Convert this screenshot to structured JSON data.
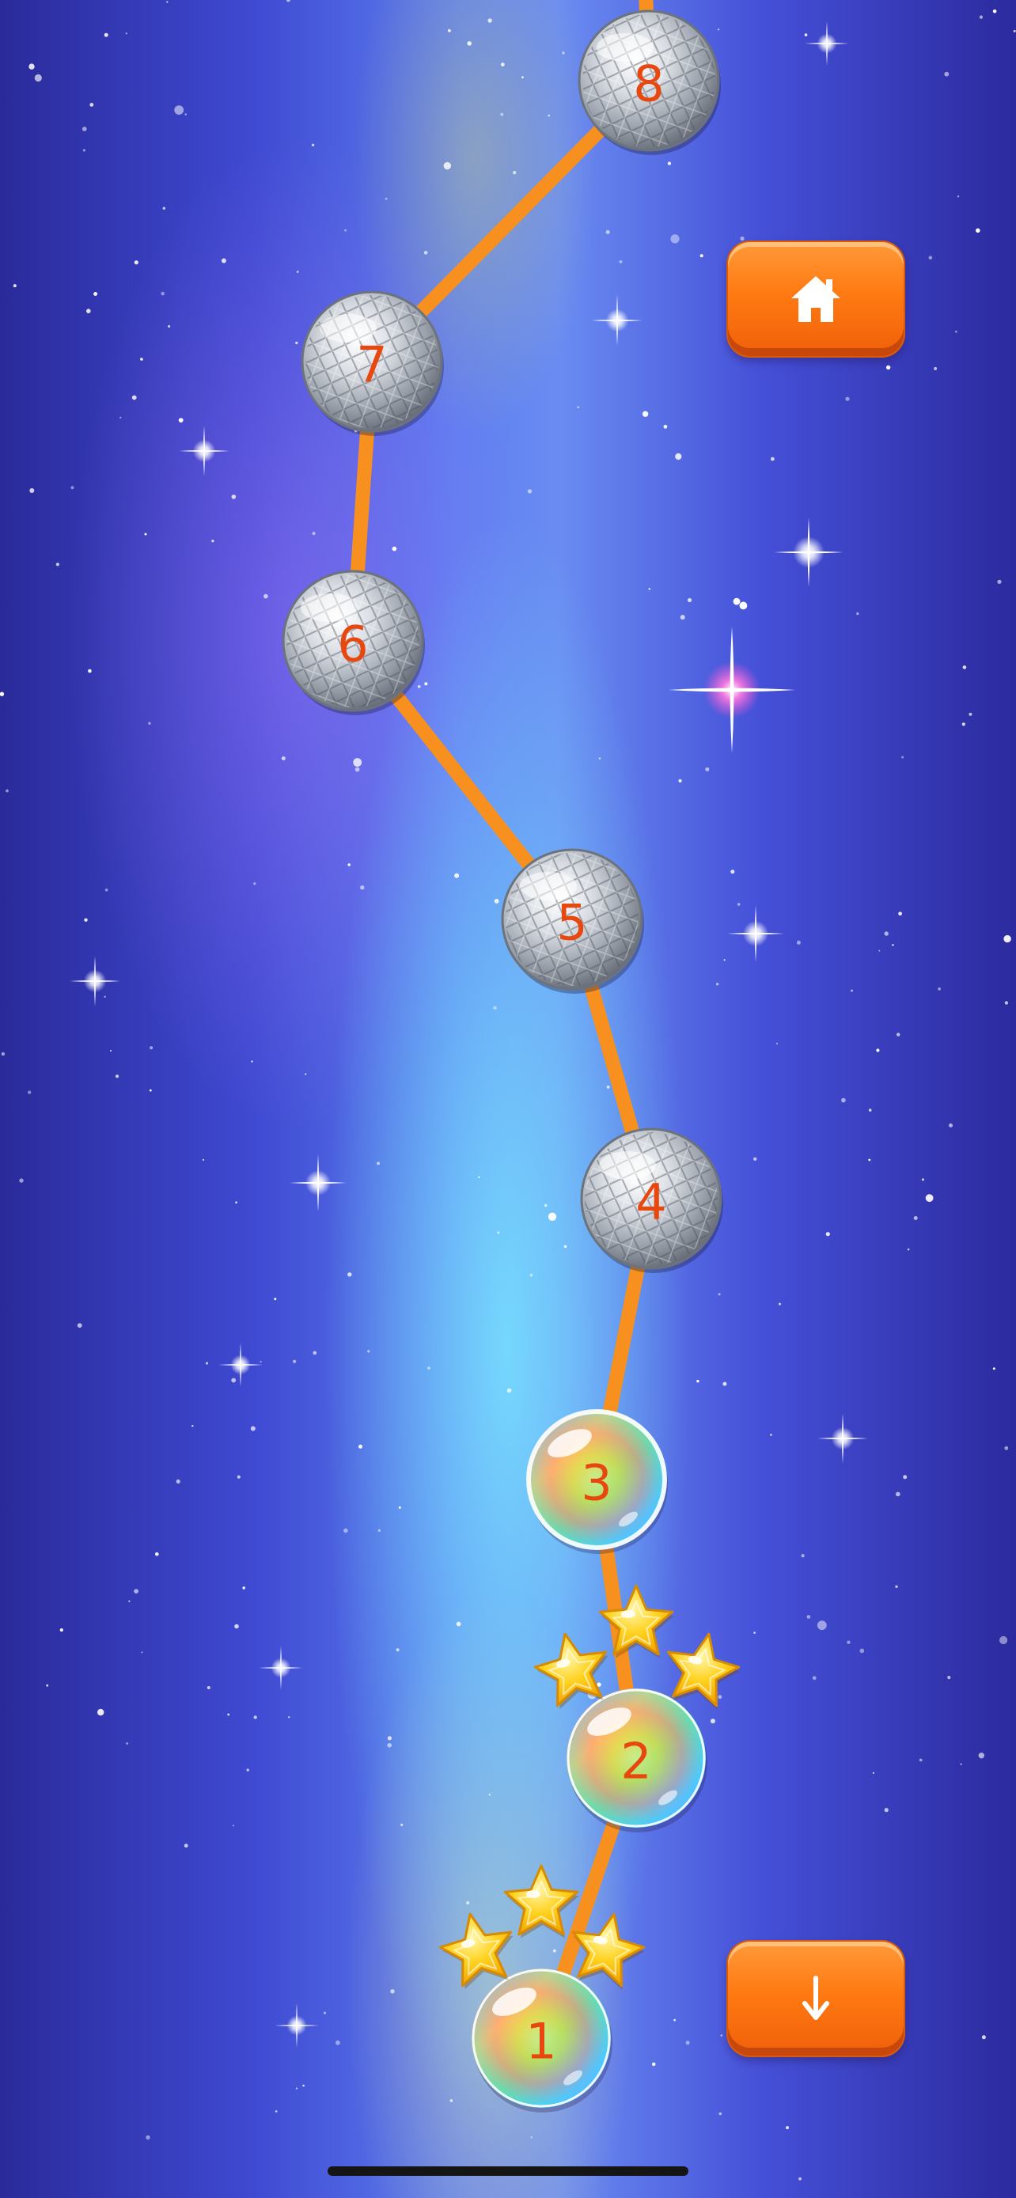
{
  "app": {
    "type": "level-select map"
  },
  "buttons": {
    "home": {
      "icon": "home-icon"
    },
    "scroll_down": {
      "icon": "arrow-down-icon"
    }
  },
  "colors": {
    "path": "#f7901e",
    "level_number": "#e8470d",
    "button_orange": "#ff7a12"
  },
  "levels": [
    {
      "number": "1",
      "state": "completed",
      "stars": 3
    },
    {
      "number": "2",
      "state": "completed",
      "stars": 3
    },
    {
      "number": "3",
      "state": "current",
      "stars": 0
    },
    {
      "number": "4",
      "state": "locked",
      "stars": 0
    },
    {
      "number": "5",
      "state": "locked",
      "stars": 0
    },
    {
      "number": "6",
      "state": "locked",
      "stars": 0
    },
    {
      "number": "7",
      "state": "locked",
      "stars": 0
    },
    {
      "number": "8",
      "state": "locked",
      "stars": 0
    }
  ]
}
